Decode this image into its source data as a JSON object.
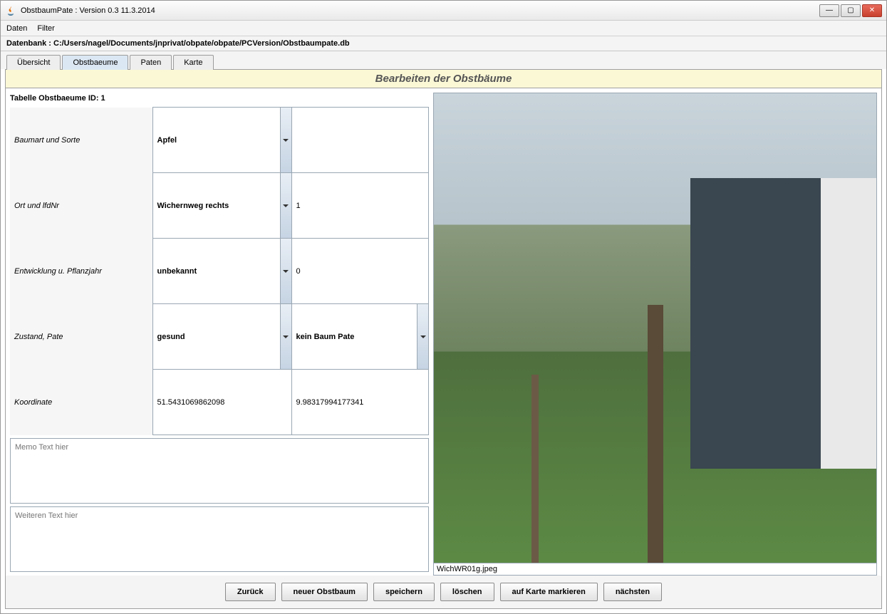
{
  "window": {
    "title": "ObstbaumPate : Version 0.3 11.3.2014"
  },
  "menubar": {
    "daten": "Daten",
    "filter": "Filter"
  },
  "db_bar": "Datenbank : C:/Users/nagel/Documents/jnprivat/obpate/obpate/PCVersion/Obstbaumpate.db",
  "tabs": {
    "uebersicht": "Übersicht",
    "obstbaeume": "Obstbaeume",
    "paten": "Paten",
    "karte": "Karte"
  },
  "panel": {
    "title": "Bearbeiten der Obstbäume"
  },
  "form": {
    "caption": "Tabelle Obstbaeume ID: 1",
    "rows": {
      "baumart_label": "Baumart und Sorte",
      "baumart_value": "Apfel",
      "baumart_extra": "",
      "ort_label": "Ort und lfdNr",
      "ort_value": "Wichernweg rechts",
      "ort_nr": "1",
      "entwicklung_label": "Entwicklung u. Pflanzjahr",
      "entwicklung_value": "unbekannt",
      "entwicklung_jahr": "0",
      "zustand_label": "Zustand, Pate",
      "zustand_value": "gesund",
      "pate_value": "kein Baum Pate",
      "koord_label": "Koordinate",
      "koord_lat": "51.5431069862098",
      "koord_lon": "9.98317994177341"
    },
    "memo_placeholder": "Memo Text hier",
    "extra_placeholder": "Weiteren Text hier"
  },
  "photo": {
    "caption": "WichWR01g.jpeg"
  },
  "buttons": {
    "zurueck": "Zurück",
    "neuer": "neuer Obstbaum",
    "speichern": "speichern",
    "loeschen": "löschen",
    "markieren": "auf Karte markieren",
    "naechsten": "nächsten"
  }
}
